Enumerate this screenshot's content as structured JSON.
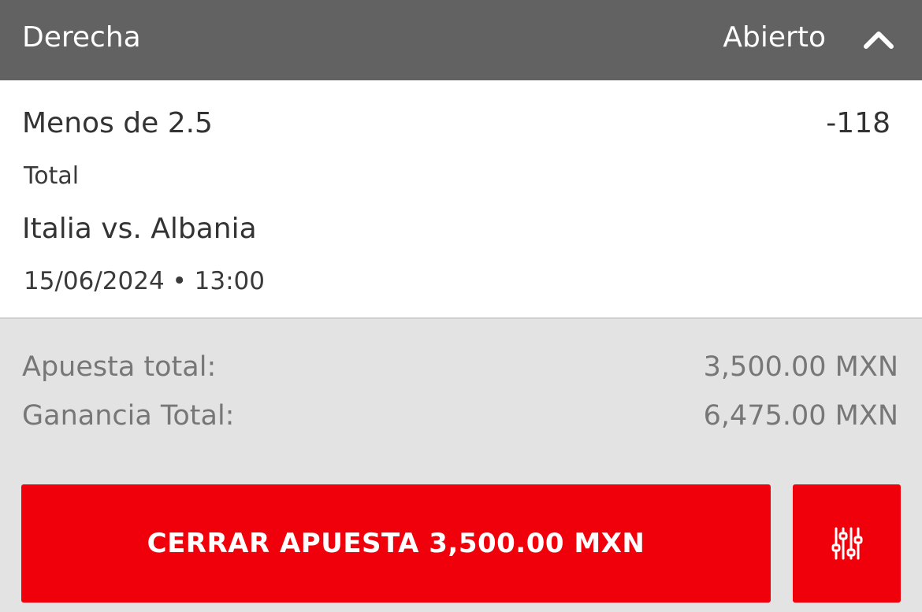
{
  "header": {
    "bet_type": "Derecha",
    "status": "Abierto",
    "collapse_icon": "chevron-up-icon"
  },
  "selection": {
    "name": "Menos de 2.5",
    "odds": "-118",
    "market": "Total",
    "event": "Italia vs. Albania",
    "datetime": "15/06/2024 • 13:00"
  },
  "summary": {
    "stake_label": "Apuesta total:",
    "stake_value": "3,500.00 MXN",
    "win_label": "Ganancia Total:",
    "win_value": "6,475.00 MXN"
  },
  "actions": {
    "cashout_label": "CERRAR APUESTA 3,500.00 MXN",
    "settings_icon": "sliders-icon"
  },
  "colors": {
    "header_bg": "#626262",
    "accent_red": "#f0000a",
    "summary_bg": "#e3e3e3"
  }
}
